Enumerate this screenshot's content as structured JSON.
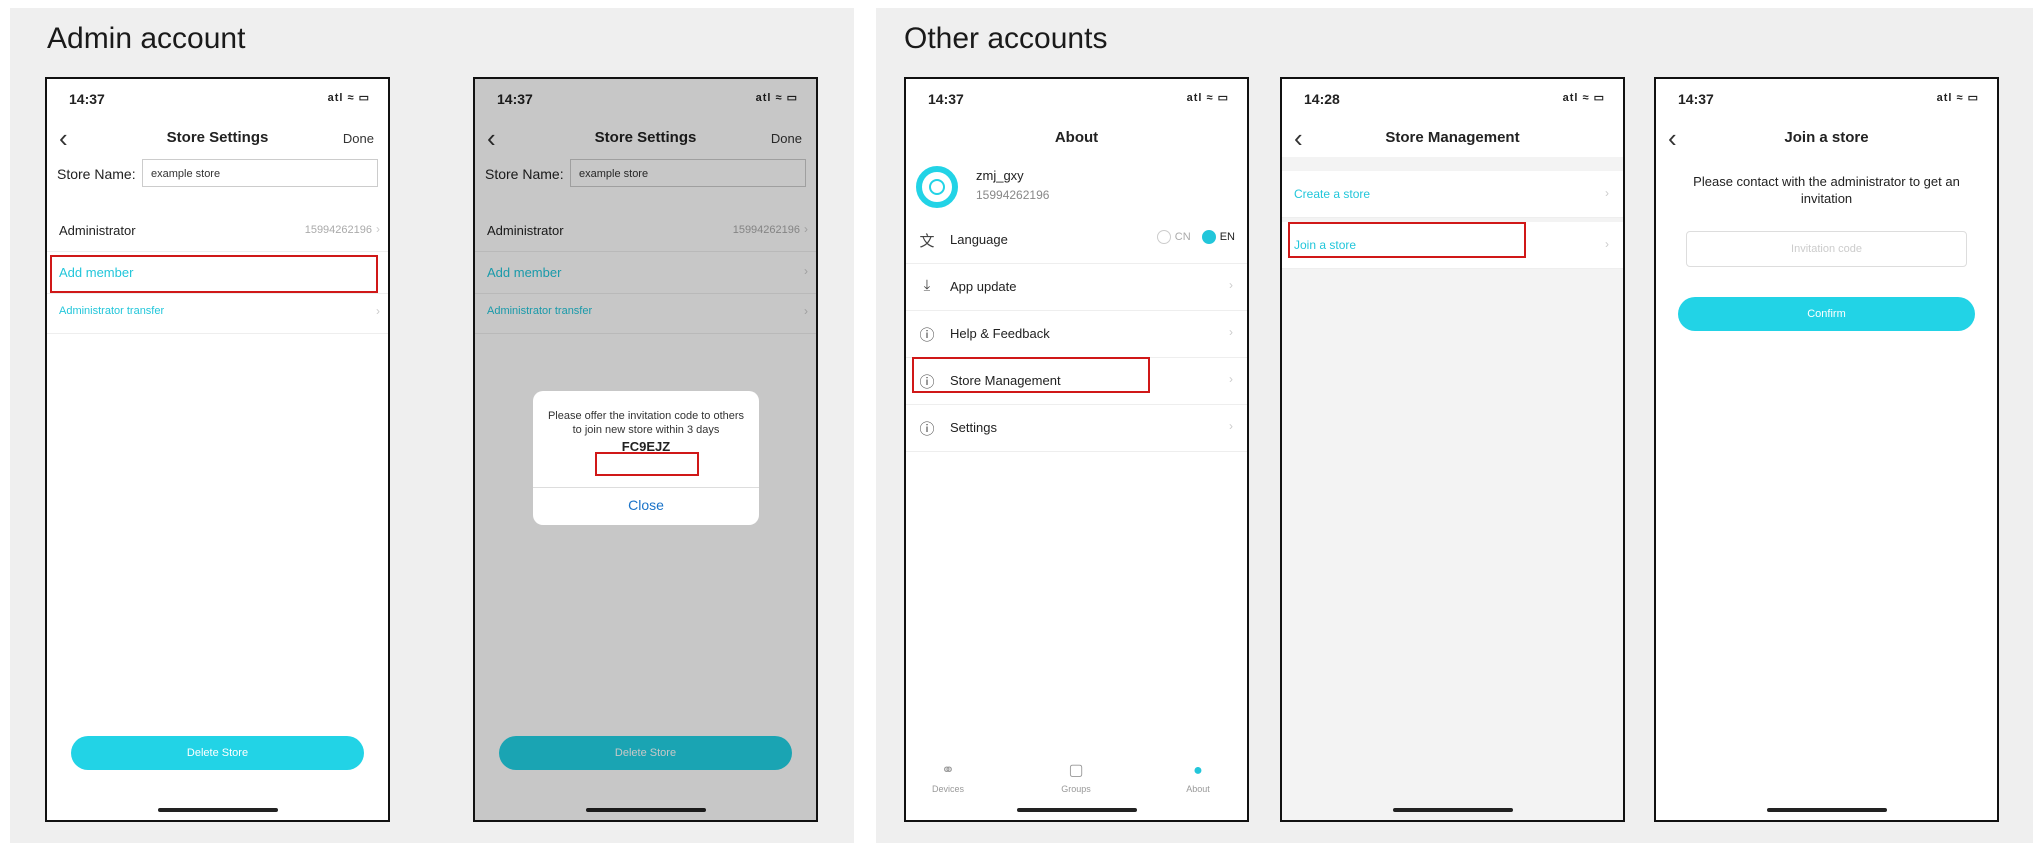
{
  "sections": {
    "admin_title": "Admin account",
    "other_title": "Other accounts"
  },
  "phone1": {
    "time": "14:37",
    "signal": "atl ≈ ▭",
    "title": "Store Settings",
    "done": "Done",
    "store_name_label": "Store Name:",
    "store_name_value": "example store",
    "admin_label": "Administrator",
    "admin_value": "15994262196",
    "add_member": "Add member",
    "admin_transfer": "Administrator transfer",
    "delete_store": "Delete Store"
  },
  "phone2": {
    "time": "14:37",
    "signal": "atl ≈ ▭",
    "title": "Store Settings",
    "done": "Done",
    "store_name_label": "Store Name:",
    "store_name_value": "example store",
    "admin_label": "Administrator",
    "admin_value": "15994262196",
    "add_member": "Add member",
    "admin_transfer": "Administrator transfer",
    "delete_store": "Delete Store",
    "dialog_message": "Please offer the invitation code to others to join new store within 3 days",
    "invite_code": "FC9EJZ",
    "dialog_close": "Close"
  },
  "phone3": {
    "time": "14:37",
    "signal": "atl ≈ ▭",
    "title": "About",
    "user_name": "zmj_gxy",
    "user_id": "15994262196",
    "language_label": "Language",
    "lang_cn": "CN",
    "lang_en": "EN",
    "app_update": "App update",
    "help_feedback": "Help & Feedback",
    "store_management": "Store Management",
    "settings": "Settings",
    "tab_devices": "Devices",
    "tab_groups": "Groups",
    "tab_about": "About"
  },
  "phone4": {
    "time": "14:28",
    "signal": "atl ≈ ▭",
    "title": "Store Management",
    "create_store": "Create a store",
    "join_store": "Join a store"
  },
  "phone5": {
    "time": "14:37",
    "signal": "atl ≈ ▭",
    "title": "Join a store",
    "message": "Please contact with the administrator to get an invitation",
    "code_placeholder": "Invitation code",
    "confirm": "Confirm"
  },
  "colors": {
    "accent": "#22d3e6",
    "highlight": "#d01818",
    "panel_bg": "#efefef"
  }
}
